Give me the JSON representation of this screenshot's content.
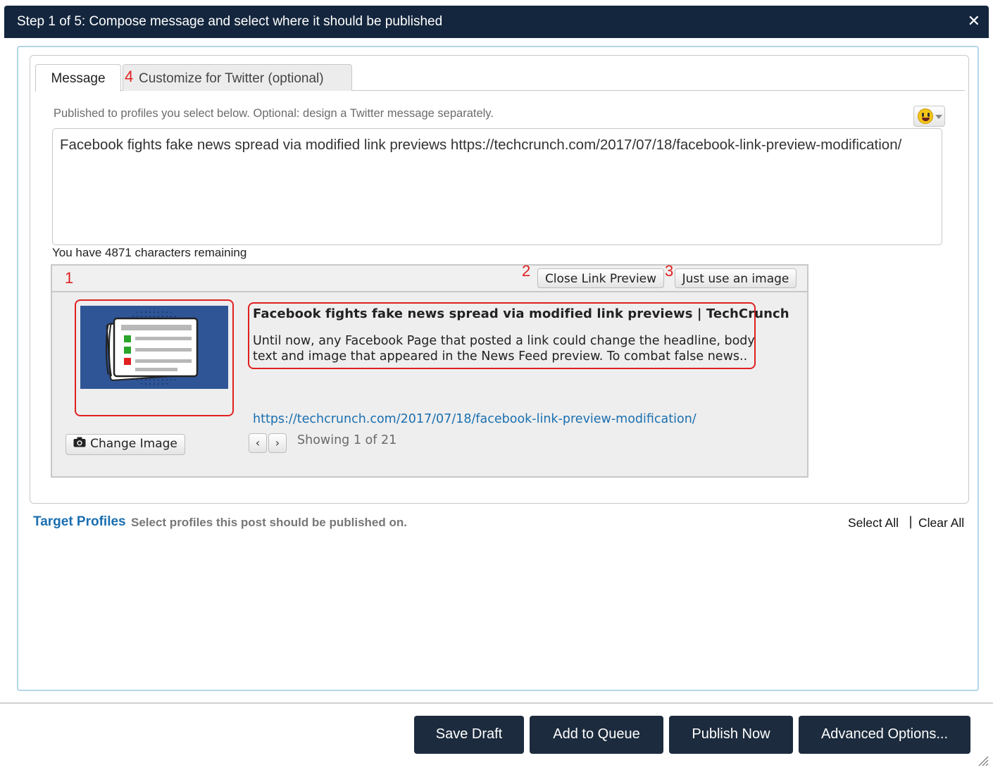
{
  "dialog": {
    "title": "Step 1 of 5: Compose message and select where it should be published",
    "close_icon": "close-icon"
  },
  "tabs": [
    {
      "label": "Message",
      "active": true
    },
    {
      "label": "Customize for Twitter (optional)",
      "active": false
    }
  ],
  "markers": {
    "m1": "1",
    "m2": "2",
    "m3": "3",
    "m4": "4"
  },
  "compose": {
    "hint": "Published to profiles you select below. Optional: design a Twitter message separately.",
    "message": "Facebook fights fake news spread via modified link previews https://techcrunch.com/2017/07/18/facebook-link-preview-modification/",
    "remaining": "You have 4871 characters remaining",
    "emoji_icon": "smiley-icon"
  },
  "preview": {
    "close_label": "Close Link Preview",
    "image_only_label": "Just use an image",
    "title": "Facebook fights fake news spread via modified link previews | TechCrunch",
    "description": "Until now, any Facebook Page that posted a link could change the headline, body text and image that appeared in the News Feed preview. To combat false news..",
    "url": "https://techcrunch.com/2017/07/18/facebook-link-preview-modification/",
    "change_image_label": "Change Image",
    "change_image_icon": "camera-icon",
    "prev_label": "‹",
    "next_label": "›",
    "showing": "Showing 1 of 21"
  },
  "targets": {
    "title": "Target Profiles",
    "description": "Select profiles this post should be published on.",
    "select_all": "Select All",
    "separator": "|",
    "clear_all": "Clear All"
  },
  "footer": {
    "save_draft": "Save Draft",
    "add_to_queue": "Add to Queue",
    "publish_now": "Publish Now",
    "advanced": "Advanced Options..."
  },
  "colors": {
    "titlebar": "#14263d",
    "accent_link": "#1a6fb0",
    "annotation_red": "#e02020",
    "dark_button": "#1c2b3d"
  }
}
